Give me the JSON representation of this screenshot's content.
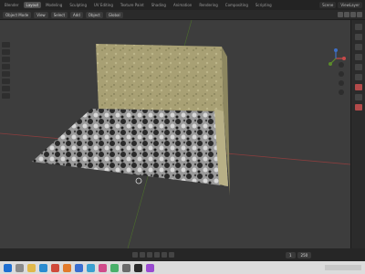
{
  "topbar": {
    "workspaces": [
      "Blender",
      "Layout",
      "Modeling",
      "Sculpting",
      "UV Editing",
      "Texture Paint",
      "Shading",
      "Animation",
      "Rendering",
      "Compositing",
      "Scripting"
    ],
    "active_index": 1,
    "scene": "Scene",
    "view_layer": "ViewLayer"
  },
  "header": {
    "mode": "Object Mode",
    "menus": [
      "View",
      "Select",
      "Add",
      "Object"
    ],
    "transform": "Global"
  },
  "colors": {
    "viewport_bg": "#3d3d3d",
    "wall": "#a8a074",
    "floor_light": "#c8c8c8",
    "floor_dark": "#2a2a2a",
    "axis_x": "#c84a4a",
    "axis_y": "#5b8a2a",
    "axis_z": "#3d6fc7"
  },
  "timeline": {
    "start": "1",
    "end": "250"
  },
  "taskbar": {
    "icons": [
      "start-icon",
      "search-icon",
      "file-explorer-icon",
      "edge-icon",
      "chrome-icon",
      "blender-icon",
      "mail-icon",
      "store-icon",
      "music-icon",
      "photos-icon",
      "settings-icon",
      "terminal-icon",
      "app-icon"
    ]
  }
}
